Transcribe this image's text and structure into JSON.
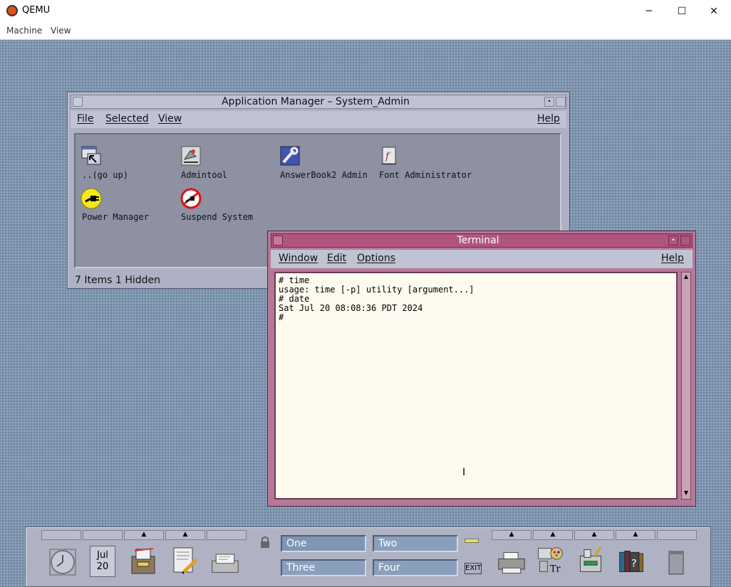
{
  "host": {
    "title": "QEMU",
    "menu": [
      "Machine",
      "View"
    ],
    "controls": {
      "minimize": "─",
      "maximize": "☐",
      "close": "✕"
    }
  },
  "app_manager": {
    "title": "Application Manager – System_Admin",
    "menu": {
      "file": "File",
      "selected": "Selected",
      "view": "View",
      "help": "Help"
    },
    "items": [
      {
        "label": "..(go up)",
        "icon": "go-up-icon"
      },
      {
        "label": "Admintool",
        "icon": "admintool-icon"
      },
      {
        "label": "AnswerBook2 Admin",
        "icon": "answerbook-icon"
      },
      {
        "label": "Font Administrator",
        "icon": "font-admin-icon"
      },
      {
        "label": "Power Manager",
        "icon": "power-manager-icon"
      },
      {
        "label": "Suspend System",
        "icon": "suspend-system-icon"
      }
    ],
    "status": "7 Items 1 Hidden"
  },
  "terminal": {
    "title": "Terminal",
    "menu": {
      "window": "Window",
      "edit": "Edit",
      "options": "Options",
      "help": "Help"
    },
    "content": "# time\nusage: time [-p] utility [argument...]\n# date\nSat Jul 20 08:08:36 PDT 2024\n#"
  },
  "front_panel": {
    "calendar": {
      "month": "Jul",
      "day": "20"
    },
    "workspaces": [
      "One",
      "Two",
      "Three",
      "Four"
    ],
    "active_workspace": "One",
    "exit_label": "EXIT"
  },
  "colors": {
    "desktop": "#7e94ae",
    "app_manager_frame": "#adb1c3",
    "terminal_frame": "#b57897",
    "terminal_bg": "#fffaef"
  }
}
